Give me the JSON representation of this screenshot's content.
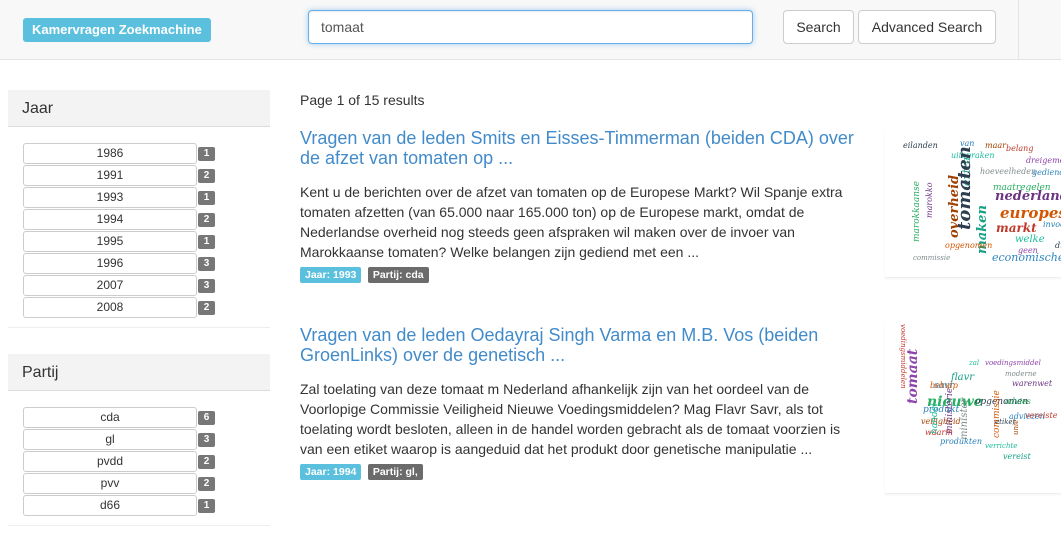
{
  "header": {
    "brand": "Kamervragen Zoekmachine",
    "search_value": "tomaat",
    "search_button": "Search",
    "advanced_button": "Advanced Search"
  },
  "facets": {
    "jaar": {
      "title": "Jaar",
      "items": [
        {
          "label": "1986",
          "count": "1"
        },
        {
          "label": "1991",
          "count": "2"
        },
        {
          "label": "1993",
          "count": "1"
        },
        {
          "label": "1994",
          "count": "2"
        },
        {
          "label": "1995",
          "count": "1"
        },
        {
          "label": "1996",
          "count": "3"
        },
        {
          "label": "2007",
          "count": "3"
        },
        {
          "label": "2008",
          "count": "2"
        }
      ]
    },
    "partij": {
      "title": "Partij",
      "items": [
        {
          "label": "cda",
          "count": "6"
        },
        {
          "label": "gl",
          "count": "3"
        },
        {
          "label": "pvdd",
          "count": "2"
        },
        {
          "label": "pvv",
          "count": "2"
        },
        {
          "label": "d66",
          "count": "1"
        }
      ]
    }
  },
  "results_meta": "Page 1 of 15 results",
  "results": [
    {
      "title": "Vragen van de leden Smits en Eisses-Timmerman (beiden CDA) over de afzet van tomaten op ...",
      "snippet": "Kent u de berichten over de afzet van tomaten op de Europese Markt? Wil Spanje extra tomaten afzetten (van 65.000 naar 165.000 ton) op de Europese markt, omdat de Nederlandse overheid nog steeds geen afspraken wil maken over de invoer van Marokkaanse tomaten? Welke belangen zijn gediend met een ...",
      "jaar_label": "Jaar: 1993",
      "partij_label": "Partij: cda",
      "wordcloud": [
        "eilanden",
        "van",
        "maar",
        "belang",
        "uitspraken",
        "dreigementen",
        "hoeveelheden",
        "gediend",
        "extra",
        "nederlandse",
        "maatregelen",
        "europese",
        "tomaten",
        "invoer",
        "overheid",
        "markt",
        "welke",
        "geen",
        "commissie",
        "economische",
        "maken",
        "marokko",
        "marokkaanse",
        "opgenomen",
        "dreigementen"
      ]
    },
    {
      "title": "Vragen van de leden Oedayraj Singh Varma en M.B. Vos (beiden GroenLinks) over de genetisch ...",
      "snippet": "Zal toelating van deze tomaat m Nederland afhankelijk zijn van het oordeel van de Voorlopige Commissie Veiligheid Nieuwe Voedingsmiddelen? Mag Flavr Savr, als tot toelating wordt besloten, alleen in de handel worden gebracht als de tomaat voorzien is van een etiket waarop is aangeduid dat het produkt door genetische manipulatie ...",
      "jaar_label": "Jaar: 1994",
      "partij_label": "Partij: gl,",
      "wordcloud": [
        "voedingsmiddelen",
        "zal",
        "voedingsmiddel",
        "moderne",
        "savr",
        "flavr",
        "warenwet",
        "nieuwe",
        "behulp",
        "opgenomen",
        "produkt",
        "veiligheid",
        "waarin",
        "handel",
        "tomaat",
        "minister",
        "adviezen",
        "vereist",
        "ministerie",
        "advies",
        "commissie",
        "etiket",
        "produkten",
        "unie",
        "vereiste",
        "verrichte"
      ]
    }
  ],
  "colors": {
    "brand": "#5bc0de",
    "link": "#428bca",
    "jaar_label": "#5bc0de",
    "partij_label": "#6b6b6b",
    "count_badge": "#777777"
  }
}
